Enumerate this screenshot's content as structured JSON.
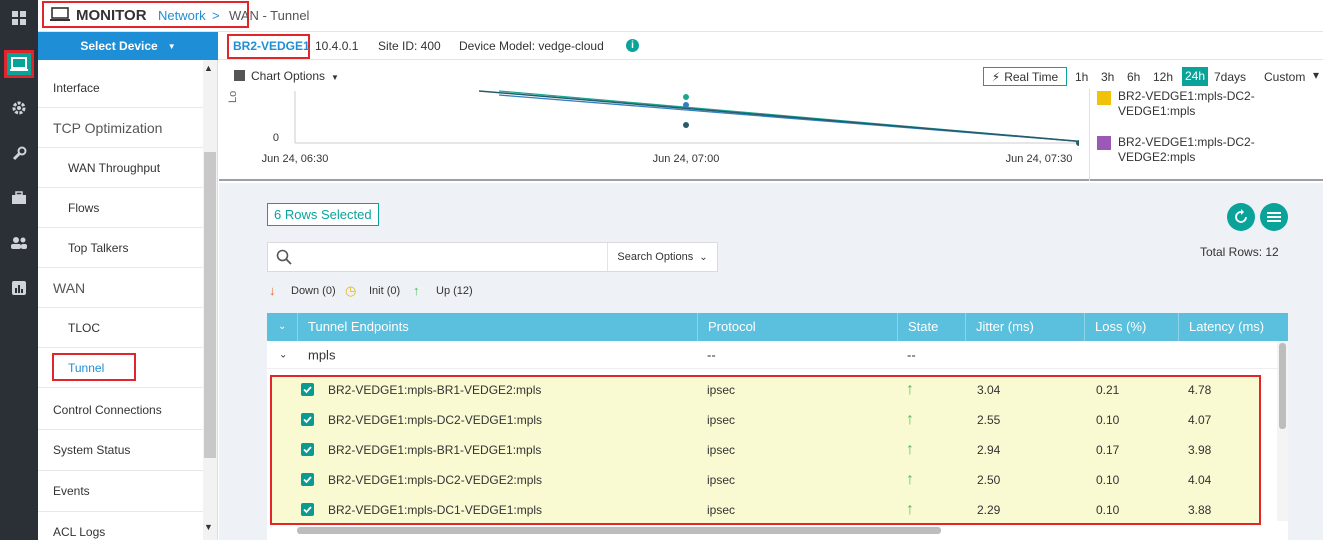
{
  "breadcrumb": {
    "section": "MONITOR",
    "link": "Network",
    "separator": ">",
    "current": "WAN - Tunnel"
  },
  "rail": {
    "icons": [
      "dashboard-icon",
      "monitor-icon",
      "gear-icon",
      "wrench-icon",
      "briefcase-icon",
      "users-icon",
      "reports-icon"
    ],
    "active": "monitor-icon"
  },
  "select_device": "Select Device",
  "device": {
    "name": "BR2-VEDGE1",
    "ip": "10.4.0.1",
    "site": "Site ID: 400",
    "model": "Device Model: vedge-cloud",
    "info_icon": "i"
  },
  "sidebar": {
    "items": [
      {
        "label": "Interface",
        "type": "item"
      },
      {
        "label": "TCP Optimization",
        "type": "category"
      },
      {
        "label": "WAN Throughput",
        "type": "sub"
      },
      {
        "label": "Flows",
        "type": "sub"
      },
      {
        "label": "Top Talkers",
        "type": "sub"
      },
      {
        "label": "WAN",
        "type": "category"
      },
      {
        "label": "TLOC",
        "type": "sub"
      },
      {
        "label": "Tunnel",
        "type": "sub-active"
      },
      {
        "label": "Control Connections",
        "type": "item"
      },
      {
        "label": "System Status",
        "type": "item"
      },
      {
        "label": "Events",
        "type": "item"
      },
      {
        "label": "ACL Logs",
        "type": "item"
      }
    ]
  },
  "chart_options": "Chart Options",
  "time_ranges": {
    "realtime": "Real Time",
    "options": [
      "1h",
      "3h",
      "6h",
      "12h",
      "24h",
      "7days",
      "Custom"
    ],
    "selected": "24h"
  },
  "chart_data": {
    "type": "line",
    "ylabel_fragment": "Lo",
    "y_tick_visible": "0",
    "x_ticks": [
      "Jun 24, 06:30",
      "Jun 24, 07:00",
      "Jun 24, 07:30"
    ],
    "series": [
      {
        "name": "BR2-VEDGE1:mpls-DC2-VEDGE1:mpls",
        "color": "#f0c20a"
      },
      {
        "name": "BR2-VEDGE1:mpls-DC2-VEDGE2:mpls",
        "color": "#9b59b6"
      }
    ]
  },
  "legend": [
    {
      "label": "BR2-VEDGE1:mpls-DC2-VEDGE1:mpls",
      "color": "#f0c20a"
    },
    {
      "label": "BR2-VEDGE1:mpls-DC2-VEDGE2:mpls",
      "color": "#9b59b6"
    }
  ],
  "rows_selected": "6 Rows Selected",
  "search": {
    "placeholder": "",
    "options_label": "Search Options"
  },
  "total_rows": "Total Rows: 12",
  "state_counts": {
    "down": "Down (0)",
    "init": "Init (0)",
    "up": "Up (12)"
  },
  "table": {
    "headers": [
      "Tunnel Endpoints",
      "Protocol",
      "State",
      "Jitter (ms)",
      "Loss (%)",
      "Latency (ms)"
    ],
    "group": {
      "name": "mpls",
      "protocol": "--",
      "state": "--"
    },
    "rows": [
      {
        "endpoint": "BR2-VEDGE1:mpls-BR1-VEDGE2:mpls",
        "protocol": "ipsec",
        "jitter": "3.04",
        "loss": "0.21",
        "latency": "4.78"
      },
      {
        "endpoint": "BR2-VEDGE1:mpls-DC2-VEDGE1:mpls",
        "protocol": "ipsec",
        "jitter": "2.55",
        "loss": "0.10",
        "latency": "4.07"
      },
      {
        "endpoint": "BR2-VEDGE1:mpls-BR1-VEDGE1:mpls",
        "protocol": "ipsec",
        "jitter": "2.94",
        "loss": "0.17",
        "latency": "3.98"
      },
      {
        "endpoint": "BR2-VEDGE1:mpls-DC2-VEDGE2:mpls",
        "protocol": "ipsec",
        "jitter": "2.50",
        "loss": "0.10",
        "latency": "4.04"
      },
      {
        "endpoint": "BR2-VEDGE1:mpls-DC1-VEDGE1:mpls",
        "protocol": "ipsec",
        "jitter": "2.29",
        "loss": "0.10",
        "latency": "3.88"
      }
    ]
  },
  "colors": {
    "accent": "#0aa39a",
    "brand_blue": "#1e8fd6",
    "highlight": "#e0262b",
    "table_header": "#5bc0de",
    "selected_row": "#fafad2"
  }
}
